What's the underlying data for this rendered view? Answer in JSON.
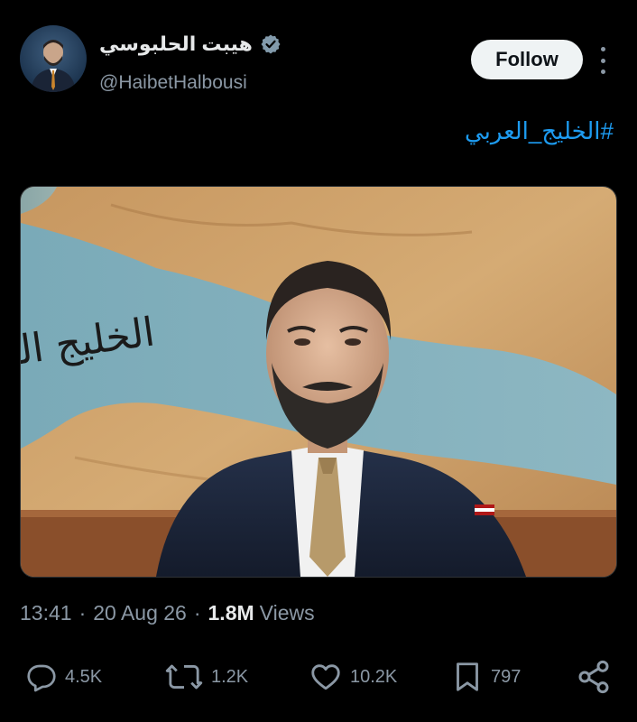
{
  "user": {
    "display_name": "هيبت الحلبوسي",
    "handle": "@HaibetHalbousi",
    "verified_icon": "verified-badge-icon"
  },
  "follow_label": "Follow",
  "tweet": {
    "hashtag": "#الخليج_العربي",
    "image_caption": "الخليج العربي"
  },
  "meta": {
    "time": "13:41",
    "date": "20 Aug 26",
    "views_count": "1.8M",
    "views_label": "Views",
    "separator": "·"
  },
  "actions": {
    "replies": "4.5K",
    "reposts": "1.2K",
    "likes": "10.2K",
    "bookmarks": "797"
  },
  "colors": {
    "background": "#000000",
    "accent": "#1d9bf0",
    "secondary_text": "#8b98a5",
    "follow_bg": "#eff3f4"
  }
}
